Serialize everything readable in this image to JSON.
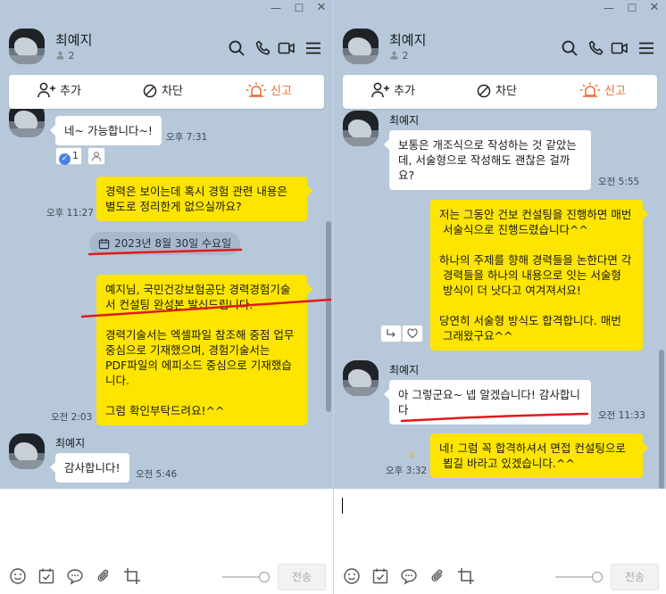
{
  "window_controls": {
    "minimize": "—",
    "maximize": "☐",
    "close": "✕"
  },
  "chat": {
    "name": "최예지",
    "member_count": "2"
  },
  "actions": {
    "add": "추가",
    "block": "차단",
    "report": "신고"
  },
  "left": {
    "messages": [
      {
        "text": "네~ 가능합니다~!",
        "time": "오후 7:31"
      },
      {
        "text": "경력은 보이는데 혹시 경험 관련 내용은\n별도로 정리한게 없으실까요?",
        "time": "오후 11:27"
      },
      {
        "text": "예지님, 국민건강보험공단 경력경험기술\n서 컨설팅 완성본 발신드립니다.\n\n경력기술서는 엑셀파일 참조해 중점 업무\n중심으로 기재했으며, 경험기술서는\nPDF파일의 에피소드 중심으로 기재했습\n니다.\n\n그럼 확인부탁드려요!^^",
        "time": "오전 2:03"
      },
      {
        "sender": "최예지",
        "text": "감사합니다!",
        "time": "오전 5:46"
      }
    ],
    "reaction_count": "1",
    "date_divider": "2023년 8월 30일 수요일"
  },
  "right": {
    "messages": [
      {
        "sender": "최예지",
        "text": "보통은 개조식으로 작성하는 것 같았는\n데, 서술형으로 작성해도 괜찮은 걸까\n요?",
        "time": "오전 5:55"
      },
      {
        "text": "저는 그동안 건보 컨설팅을 진행하면 매번\n 서술식으로 진행드렸습니다^^\n\n하나의 주제를 향해 경력들을 논한다면 각\n 경력들을 하나의 내용으로 잇는 서술형\n 방식이 더 낫다고 여겨져서요!\n\n당연히 서술형 방식도 합격합니다. 매번\n 그래왔구요^^"
      },
      {
        "sender": "최예지",
        "text": "아 그렇군요~ 넵 알겠습니다! 감사합니\n다",
        "time": "오전 11:33"
      },
      {
        "text": "네! 그럼 꼭 합격하셔서 면접 컨설팅으로\n 뵙길 바라고 있겠습니다.^^",
        "time": "오후 3:32",
        "unread": "1"
      }
    ]
  },
  "input": {
    "send_label": "전송"
  },
  "colors": {
    "chat_bg": "#b6c8da",
    "my_bubble": "#fee501",
    "other_bubble": "#ffffff",
    "report": "#ee6a2e",
    "annotation_line": "#e01a1a"
  }
}
